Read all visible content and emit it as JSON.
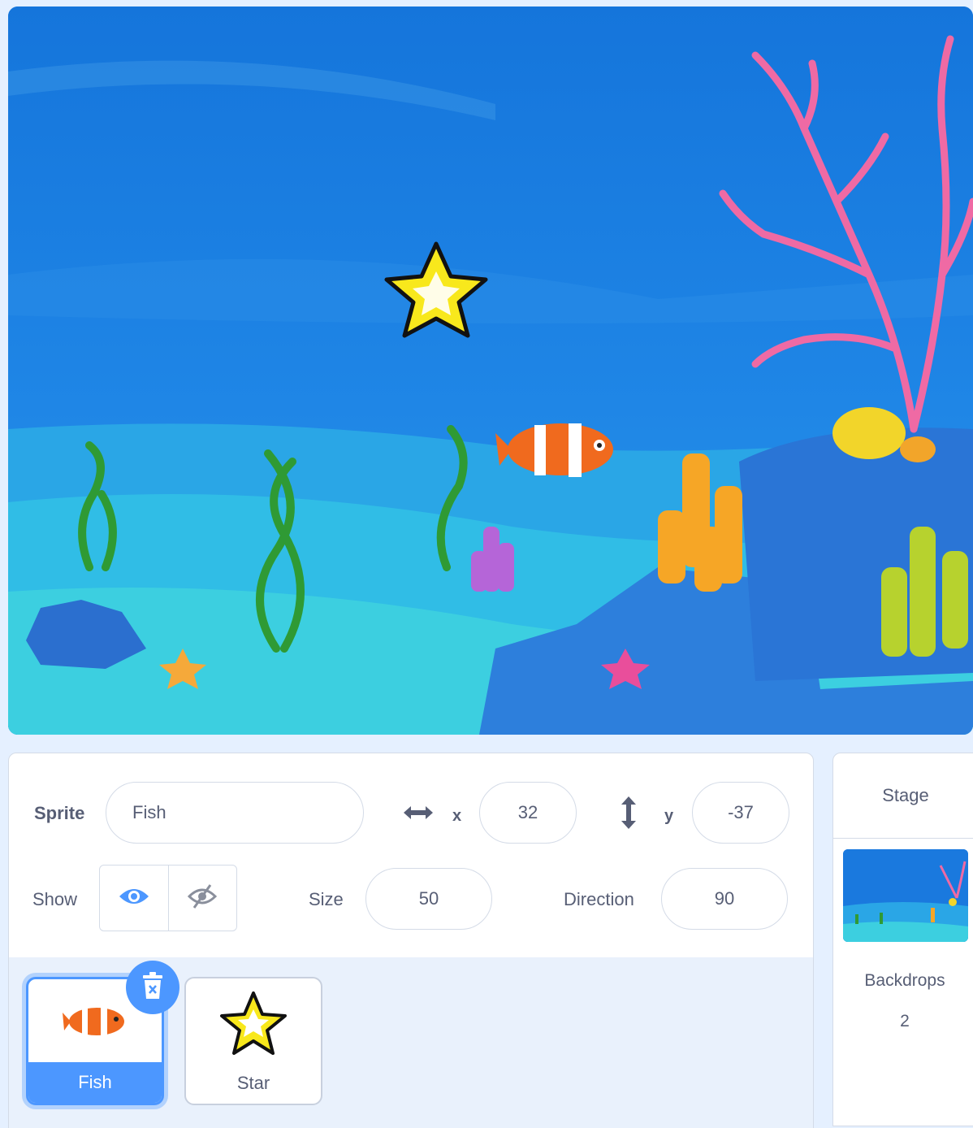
{
  "stage": {
    "scene": "underwater"
  },
  "sprite_info": {
    "sprite_label": "Sprite",
    "sprite_name": "Fish",
    "x_label": "x",
    "x_value": "32",
    "y_label": "y",
    "y_value": "-37",
    "show_label": "Show",
    "size_label": "Size",
    "size_value": "50",
    "direction_label": "Direction",
    "direction_value": "90"
  },
  "sprites": [
    {
      "name": "Fish",
      "selected": true,
      "icon": "clownfish-icon"
    },
    {
      "name": "Star",
      "selected": false,
      "icon": "star-icon"
    }
  ],
  "stage_pane": {
    "title": "Stage",
    "backdrops_label": "Backdrops",
    "backdrops_count": "2"
  },
  "colors": {
    "accent": "#4c97ff",
    "text": "#575e75",
    "panel_bg": "#e9f1fc"
  }
}
